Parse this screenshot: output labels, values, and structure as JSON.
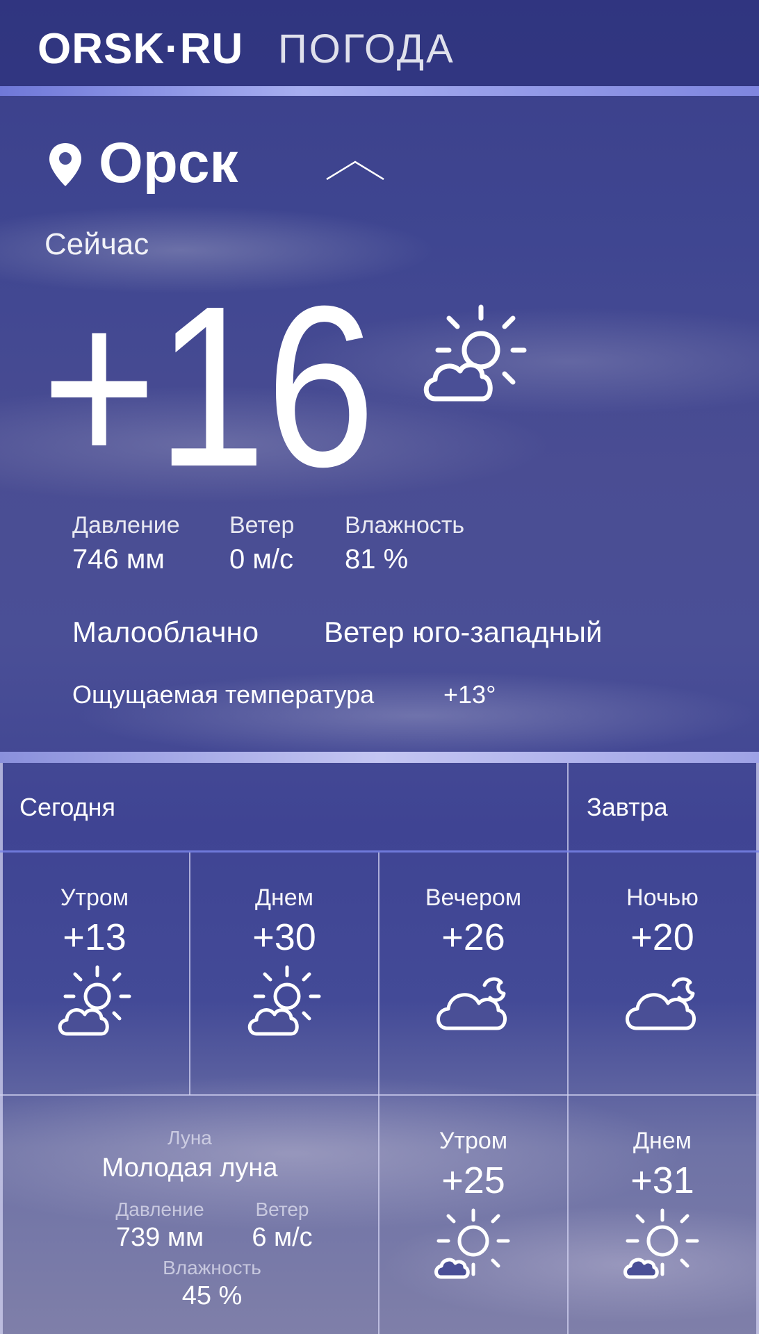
{
  "header": {
    "logo": "ORSK·RU",
    "section": "ПОГОДА"
  },
  "location": {
    "city": "Орск"
  },
  "current": {
    "label": "Сейчас",
    "temperature": "+16",
    "condition_icon": "partly-cloudy-sun-icon",
    "pressure_label": "Давление",
    "pressure_value": "746 мм",
    "wind_label": "Ветер",
    "wind_value": "0 м/с",
    "humidity_label": "Влажность",
    "humidity_value": "81 %",
    "condition": "Малооблачно",
    "wind_direction": "Ветер юго-западный",
    "feels_like_label": "Ощущаемая температура",
    "feels_like_value": "+13°"
  },
  "forecast": {
    "today_label": "Сегодня",
    "tomorrow_label": "Завтра",
    "periods": [
      {
        "label": "Утром",
        "temp": "+13",
        "icon": "partly-cloudy-sun-icon"
      },
      {
        "label": "Днем",
        "temp": "+30",
        "icon": "partly-cloudy-sun-icon"
      },
      {
        "label": "Вечером",
        "temp": "+26",
        "icon": "cloudy-moon-icon"
      },
      {
        "label": "Ночью",
        "temp": "+20",
        "icon": "cloudy-moon-icon"
      }
    ],
    "tomorrow_periods": [
      {
        "label": "Утром",
        "temp": "+25",
        "icon": "sun-with-cloud-icon"
      },
      {
        "label": "Днем",
        "temp": "+31",
        "icon": "sun-with-cloud-icon"
      }
    ],
    "tomorrow_details": {
      "moon_label": "Луна",
      "moon_value": "Молодая луна",
      "pressure_label": "Давление",
      "pressure_value": "739 мм",
      "wind_label": "Ветер",
      "wind_value": "6 м/с",
      "humidity_label": "Влажность",
      "humidity_value": "45 %"
    }
  },
  "colors": {
    "accent_line": "#8f97e6",
    "grid_line": "#7882e6",
    "text": "#ffffff"
  }
}
